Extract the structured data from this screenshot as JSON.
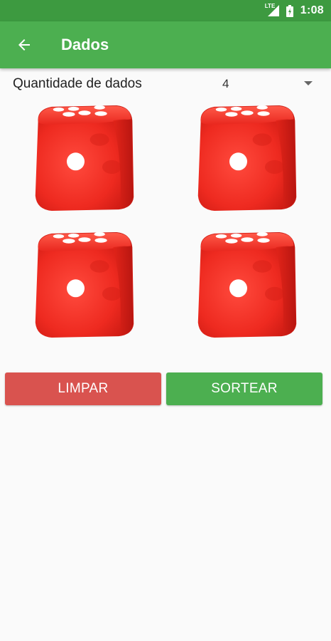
{
  "status_bar": {
    "network": "LTE",
    "time": "1:08"
  },
  "app_bar": {
    "title": "Dados",
    "back_icon": "arrow-left-icon"
  },
  "quantity": {
    "label": "Quantidade de dados",
    "selected": "4"
  },
  "dice": [
    {
      "face": "die-face-icon"
    },
    {
      "face": "die-face-icon"
    },
    {
      "face": "die-face-icon"
    },
    {
      "face": "die-face-icon"
    }
  ],
  "buttons": {
    "clear": "LIMPAR",
    "roll": "SORTEAR"
  },
  "colors": {
    "status_bar": "#3d9a40",
    "app_bar": "#4caf50",
    "clear": "#d9534f",
    "roll": "#4caf50",
    "die": "#e8261e"
  }
}
